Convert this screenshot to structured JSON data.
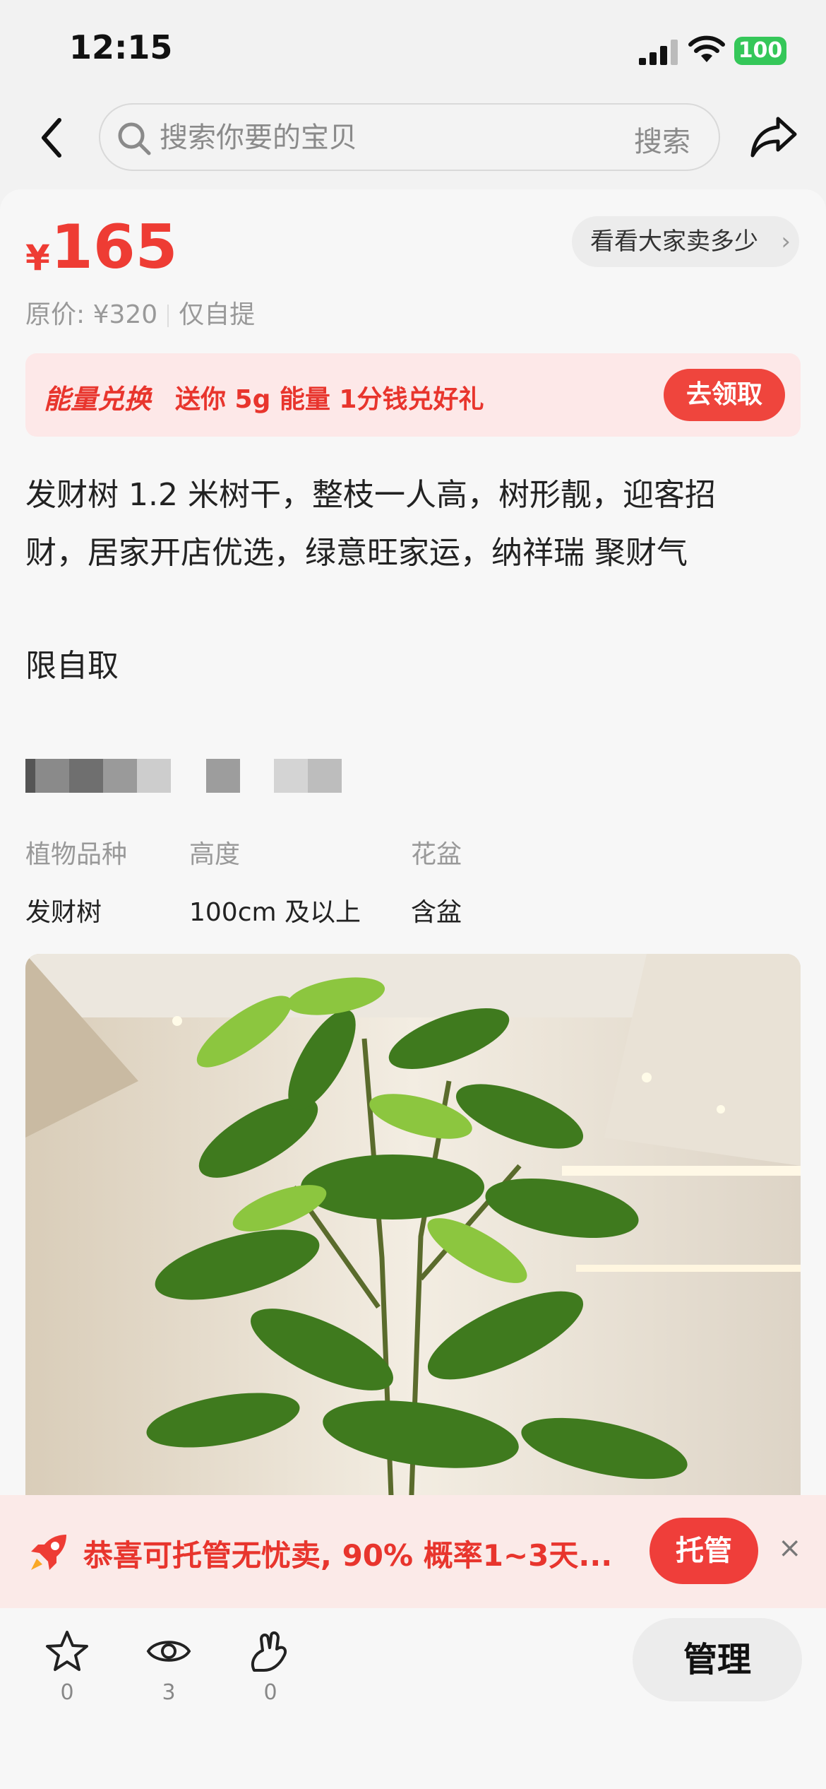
{
  "status_bar": {
    "time": "12:15",
    "battery": "100"
  },
  "nav": {
    "search_placeholder": "搜索你要的宝贝",
    "search_submit": "搜索"
  },
  "price": {
    "currency": "¥",
    "value": "165",
    "compare_label": "看看大家卖多少",
    "original": "原价: ¥320",
    "delivery": "仅自提"
  },
  "promo": {
    "tag": "能量兑换",
    "text": "送你 5g 能量 1分钱兑好礼",
    "button": "去领取"
  },
  "description": {
    "line1": "发财树 1.2 米树干，整枝一人高，树形靓，迎客招",
    "line2": "财，居家开店优选，绿意旺家运，纳祥瑞 聚财气",
    "pickup": "限自取"
  },
  "attributes": [
    {
      "label": "植物品种",
      "value": "发财树"
    },
    {
      "label": "高度",
      "value": "100cm 及以上"
    },
    {
      "label": "花盆",
      "value": "含盆"
    }
  ],
  "toast": {
    "text": "恭喜可托管无忧卖, 90% 概率1~3天...",
    "button": "托管",
    "close": "×"
  },
  "bottom": {
    "favorites": "0",
    "views": "3",
    "likes": "0",
    "manage": "管理"
  },
  "colors": {
    "accent": "#ee3c34",
    "background": "#f2f2f2"
  }
}
